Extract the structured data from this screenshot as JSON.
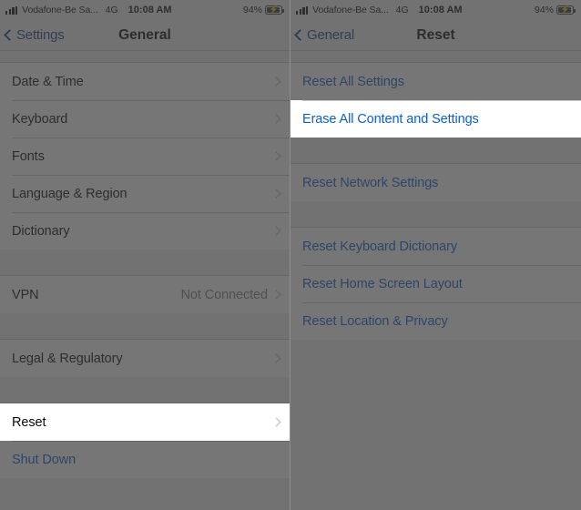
{
  "theme": {
    "accent_blue": "#0b5fd0",
    "highlight_blue": "#3b95f0",
    "list_bg": "#ffffff",
    "group_bg": "#f2f1f6",
    "separator": "#c9c8cd",
    "value_gray": "#7f7f84",
    "dim_overlay": "rgba(60,60,60,0.70)"
  },
  "left": {
    "status_bar": {
      "signal_icon": "cellular-bars-icon",
      "carrier": "Vodafone-Be Sa...",
      "network_type": "4G",
      "time": "10:08 AM",
      "battery_percent": "94%",
      "battery_icon": "battery-charging-icon"
    },
    "nav": {
      "back_icon": "chevron-left-icon",
      "back_label": "Settings",
      "title": "General"
    },
    "groups": [
      {
        "rows": [
          {
            "label": "Date & Time",
            "value": "",
            "accessory": "chevron-right-icon",
            "style": "default",
            "highlighted": false
          },
          {
            "label": "Keyboard",
            "value": "",
            "accessory": "chevron-right-icon",
            "style": "default",
            "highlighted": false
          },
          {
            "label": "Fonts",
            "value": "",
            "accessory": "chevron-right-icon",
            "style": "default",
            "highlighted": false
          },
          {
            "label": "Language & Region",
            "value": "",
            "accessory": "chevron-right-icon",
            "style": "default",
            "highlighted": false
          },
          {
            "label": "Dictionary",
            "value": "",
            "accessory": "chevron-right-icon",
            "style": "default",
            "highlighted": false
          }
        ]
      },
      {
        "rows": [
          {
            "label": "VPN",
            "value": "Not Connected",
            "accessory": "chevron-right-icon",
            "style": "default",
            "highlighted": false
          }
        ]
      },
      {
        "rows": [
          {
            "label": "Legal & Regulatory",
            "value": "",
            "accessory": "chevron-right-icon",
            "style": "default",
            "highlighted": false
          }
        ]
      },
      {
        "rows": [
          {
            "label": "Reset",
            "value": "",
            "accessory": "chevron-right-icon",
            "style": "default",
            "highlighted": true
          },
          {
            "label": "Shut Down",
            "value": "",
            "accessory": "",
            "style": "blue",
            "highlighted": false
          }
        ]
      }
    ]
  },
  "right": {
    "status_bar": {
      "signal_icon": "cellular-bars-icon",
      "carrier": "Vodafone-Be Sa...",
      "network_type": "4G",
      "time": "10:08 AM",
      "battery_percent": "94%",
      "battery_icon": "battery-charging-icon"
    },
    "nav": {
      "back_icon": "chevron-left-icon",
      "back_label": "General",
      "title": "Reset"
    },
    "groups": [
      {
        "rows": [
          {
            "label": "Reset All Settings",
            "value": "",
            "accessory": "",
            "style": "blue",
            "highlighted": false
          },
          {
            "label": "Erase All Content and Settings",
            "value": "",
            "accessory": "",
            "style": "blue",
            "highlighted": true
          }
        ]
      },
      {
        "rows": [
          {
            "label": "Reset Network Settings",
            "value": "",
            "accessory": "",
            "style": "blue",
            "highlighted": false
          }
        ]
      },
      {
        "rows": [
          {
            "label": "Reset Keyboard Dictionary",
            "value": "",
            "accessory": "",
            "style": "blue",
            "highlighted": false
          },
          {
            "label": "Reset Home Screen Layout",
            "value": "",
            "accessory": "",
            "style": "blue",
            "highlighted": false
          },
          {
            "label": "Reset Location & Privacy",
            "value": "",
            "accessory": "",
            "style": "blue",
            "highlighted": false
          }
        ]
      }
    ]
  }
}
